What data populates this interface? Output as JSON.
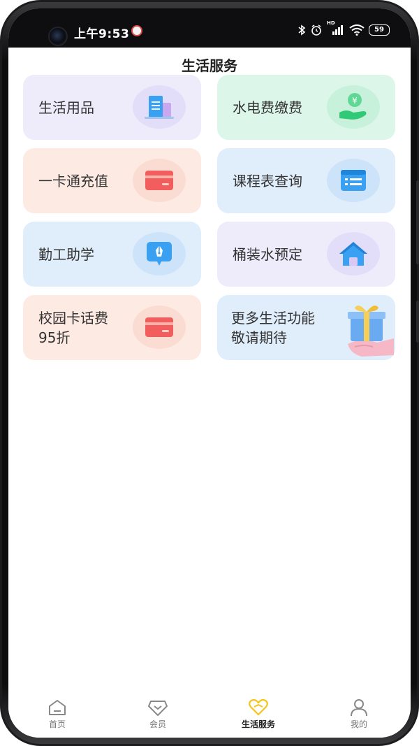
{
  "status_bar": {
    "time": "上午9:53",
    "battery": "59",
    "network_badge": "HD"
  },
  "page": {
    "title": "生活服务"
  },
  "services": [
    {
      "label": "生活用品",
      "icon": "documents-icon",
      "bg": "#eeebfb",
      "bubble": "#e2defa"
    },
    {
      "label": "水电费缴费",
      "icon": "yuan-hand-icon",
      "bg": "#dcf7ea",
      "bubble": "#c8f1dc"
    },
    {
      "label": "一卡通充值",
      "icon": "card-icon",
      "bg": "#fdeae3",
      "bubble": "#fbdcd2"
    },
    {
      "label": "课程表查询",
      "icon": "schedule-icon",
      "bg": "#e0eefc",
      "bubble": "#cde3fa"
    },
    {
      "label": "勤工助学",
      "icon": "pen-chat-icon",
      "bg": "#e0eefc",
      "bubble": "#cde3fa"
    },
    {
      "label": "桶装水预定",
      "icon": "house-icon",
      "bg": "#eeebfb",
      "bubble": "#e2defa"
    },
    {
      "label": "校园卡话费\n95折",
      "icon": "card-icon",
      "bg": "#fdeae3",
      "bubble": "#fbdcd2"
    },
    {
      "label": "更多生活功能\n敬请期待",
      "icon": "gift-hand-icon",
      "bg": "#e0eefc",
      "bubble": ""
    }
  ],
  "bottom_nav": {
    "items": [
      {
        "label": "首页",
        "icon": "home-icon",
        "active": false
      },
      {
        "label": "会员",
        "icon": "member-icon",
        "active": false
      },
      {
        "label": "生活服务",
        "icon": "heart-icon",
        "active": true
      },
      {
        "label": "我的",
        "icon": "user-icon",
        "active": false
      }
    ],
    "active_color": "#f5c518"
  }
}
